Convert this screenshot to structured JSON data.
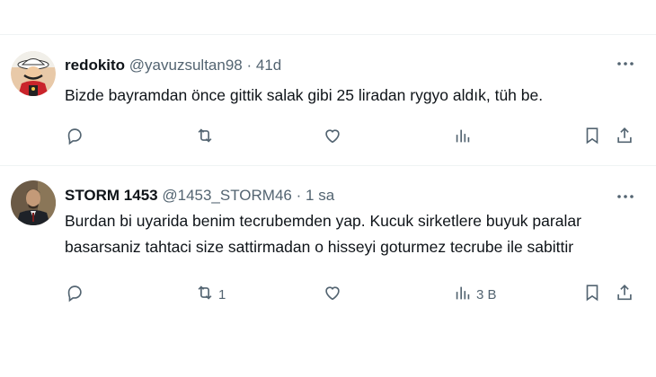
{
  "colors": {
    "text": "#0f1419",
    "muted": "#536471",
    "divider": "#eff3f4"
  },
  "tweets": [
    {
      "name": "redokito",
      "handle": "@yavuzsultan98",
      "time": "41d",
      "text": "Bizde bayramdan önce gittik salak gibi 25 liradan rygyo aldık, tüh be.",
      "replies": "",
      "retweets": "",
      "likes": "",
      "views": ""
    },
    {
      "name": "STORM 1453",
      "handle": "@1453_STORM46",
      "time": "1 sa",
      "text": "Burdan bi uyarida benim tecrubemden yap. Kucuk sirketlere buyuk paralar basarsaniz tahtaci size sattirmadan o hisseyi goturmez tecrube ile sabittir",
      "replies": "",
      "retweets": "1",
      "likes": "",
      "views": "3 B"
    }
  ],
  "icons": [
    "more-icon",
    "reply-icon",
    "retweet-icon",
    "like-icon",
    "views-icon",
    "bookmark-icon",
    "share-icon"
  ]
}
